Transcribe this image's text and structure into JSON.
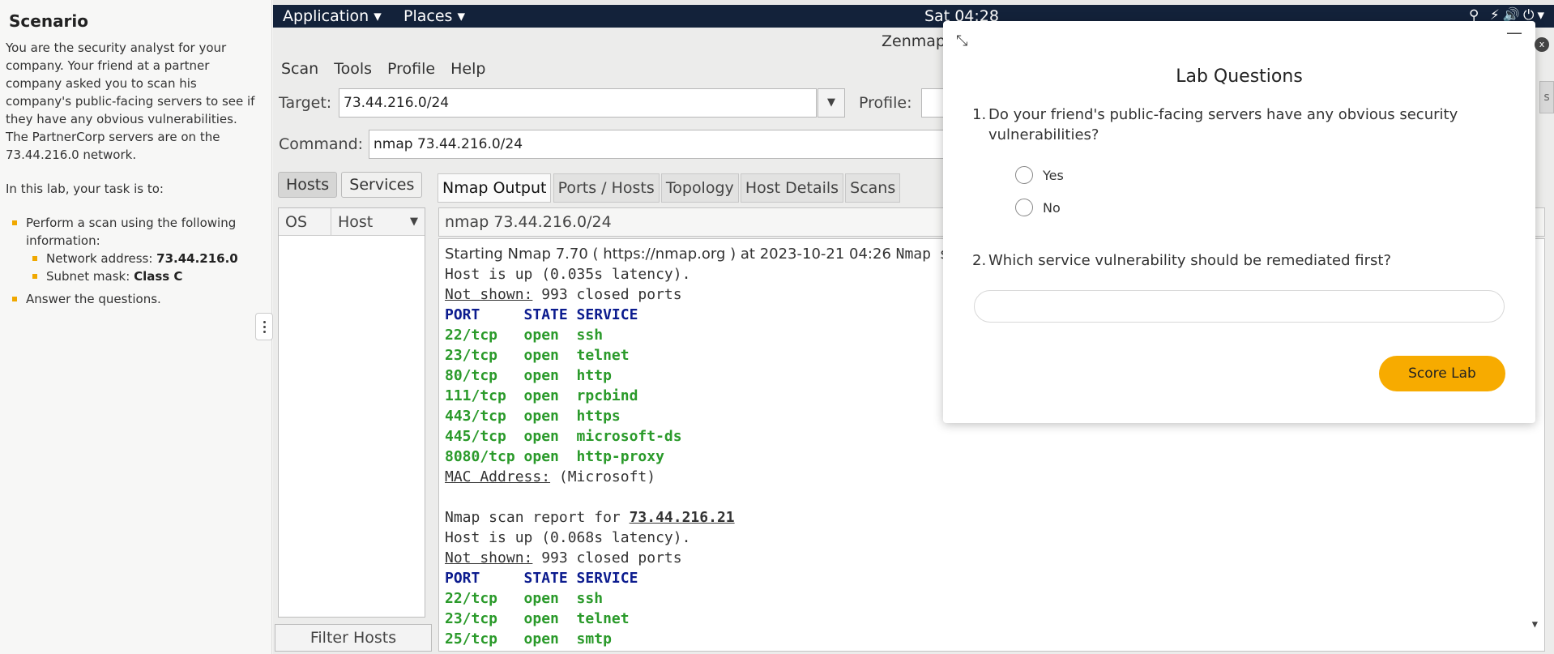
{
  "scenario": {
    "title": "Scenario",
    "intro": "You are the security analyst for your company. Your friend at a partner company asked you to scan his company's public-facing servers to see if they have any obvious vulnerabilities. The PartnerCorp servers are on the 73.44.216.0 network.",
    "task_intro": "In this lab, your task is to:",
    "task1": "Perform a scan using the following information:",
    "net_label": "Network address: ",
    "net_value": "73.44.216.0",
    "mask_label": "Subnet mask: ",
    "mask_value": "Class C",
    "task2": "Answer the questions."
  },
  "topbar": {
    "application": "Application ▾",
    "places": "Places ▾",
    "clock": "Sat 04:28",
    "tray": "⚲ ⚡🔊⏻▾"
  },
  "window": {
    "title": "Zenmap",
    "menu": [
      "Scan",
      "Tools",
      "Profile",
      "Help"
    ],
    "target_label": "Target:",
    "target_value": "73.44.216.0/24",
    "profile_label": "Profile:",
    "command_label": "Command:",
    "command_value": "nmap 73.44.216.0/24",
    "hosts_btn": "Hosts",
    "services_btn": "Services",
    "col_os": "OS",
    "col_host": "Host",
    "filter_hosts": "Filter Hosts",
    "tabs": [
      "Nmap Output",
      "Ports / Hosts",
      "Topology",
      "Host Details",
      "Scans"
    ],
    "output_command": "nmap 73.44.216.0/24"
  },
  "output": {
    "starting": "Starting Nmap 7.70 ( https://nmap.org ) at 2023-10-21 04:26 ",
    "starting_tail": "Nmap sca",
    "host_up_1": "Host is up (0.035s latency).",
    "not_shown_label": "Not shown:",
    "not_shown_value": " 993 closed ports",
    "header": "PORT     STATE SERVICE",
    "ports_1": [
      "22/tcp   open  ssh",
      "23/tcp   open  telnet",
      "80/tcp   open  http",
      "111/tcp  open  rpcbind",
      "443/tcp  open  https",
      "445/tcp  open  microsoft-ds",
      "8080/tcp open  http-proxy"
    ],
    "mac_label": "MAC Address:",
    "mac_value": " (Microsoft)",
    "report_prefix": "Nmap scan report for ",
    "report_addr": "73.44.216.21",
    "host_up_2": "Host is up (0.068s latency).",
    "ports_2": [
      "22/tcp   open  ssh",
      "23/tcp   open  telnet",
      "25/tcp   open  smtp"
    ]
  },
  "modal": {
    "title": "Lab Questions",
    "q1_num": "1.",
    "q1": "Do your friend's public-facing servers have any obvious security vulnerabilities?",
    "opt_yes": "Yes",
    "opt_no": "No",
    "q2_num": "2.",
    "q2": "Which service vulnerability should be remediated first?",
    "answer_value": "",
    "score_button": "Score Lab"
  },
  "colors": {
    "accent": "#f7ab00",
    "topbar": "#13223a",
    "port_green": "#2a9a2a",
    "header_blue": "#0b1b8e"
  }
}
